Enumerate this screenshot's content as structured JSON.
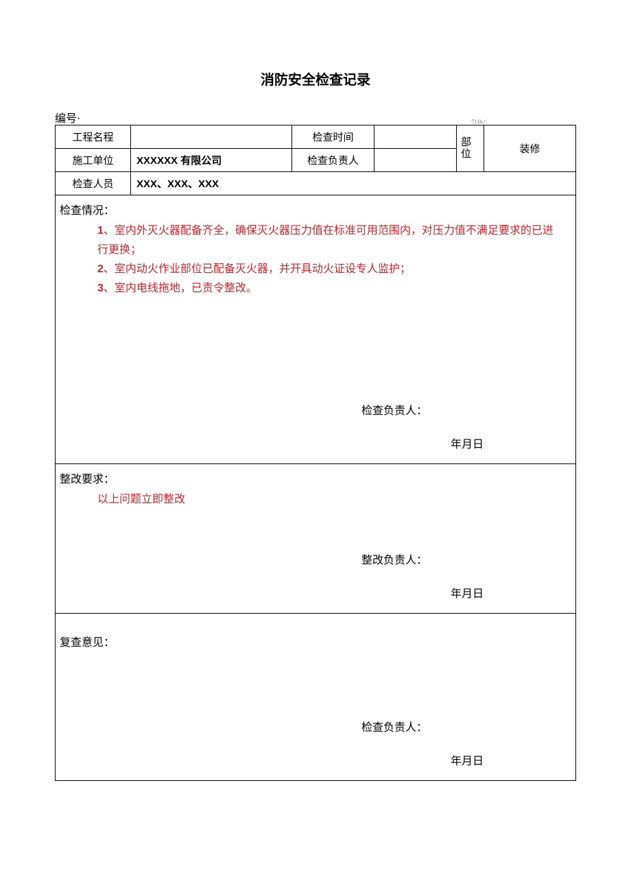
{
  "title": "消防安全检查记录",
  "bianhao_label": "编号",
  "bianhao_dot": "·",
  "small_mark": "·711b./·",
  "header": {
    "project_name_label": "工程名程",
    "project_name_value": "",
    "check_time_label": "检查时间",
    "check_time_value": "",
    "dept_label": "部位",
    "dept_value": "装修",
    "construction_unit_label": "施工单位",
    "construction_unit_value": "XXXXXX 有限公司",
    "check_leader_label": "检查负责人",
    "check_leader_value": "",
    "check_staff_label": "检查人员",
    "check_staff_value": "XXX、XXX、XXX"
  },
  "section1": {
    "header": "检查情况：",
    "item1_num": "1",
    "item1_text": "、室内外灭火器配备齐全，确保灭火器压力值在标准可用范围内，对压力值不满足要求的已进行更换；",
    "item2_num": "2",
    "item2_text": "、室内动火作业部位已配备灭火器，并开具动火证设专人监护；",
    "item3_num": "3",
    "item3_text": "、室内电线拖地，已责令整改。",
    "sign_label": "检查负责人：",
    "date_label": "年月日"
  },
  "section2": {
    "header": "整改要求：",
    "content": "以上问题立即整改",
    "sign_label": "整改负责人：",
    "date_label": "年月日"
  },
  "section3": {
    "header": "复查意见：",
    "sign_label": "检查负责人：",
    "date_label": "年月日"
  }
}
